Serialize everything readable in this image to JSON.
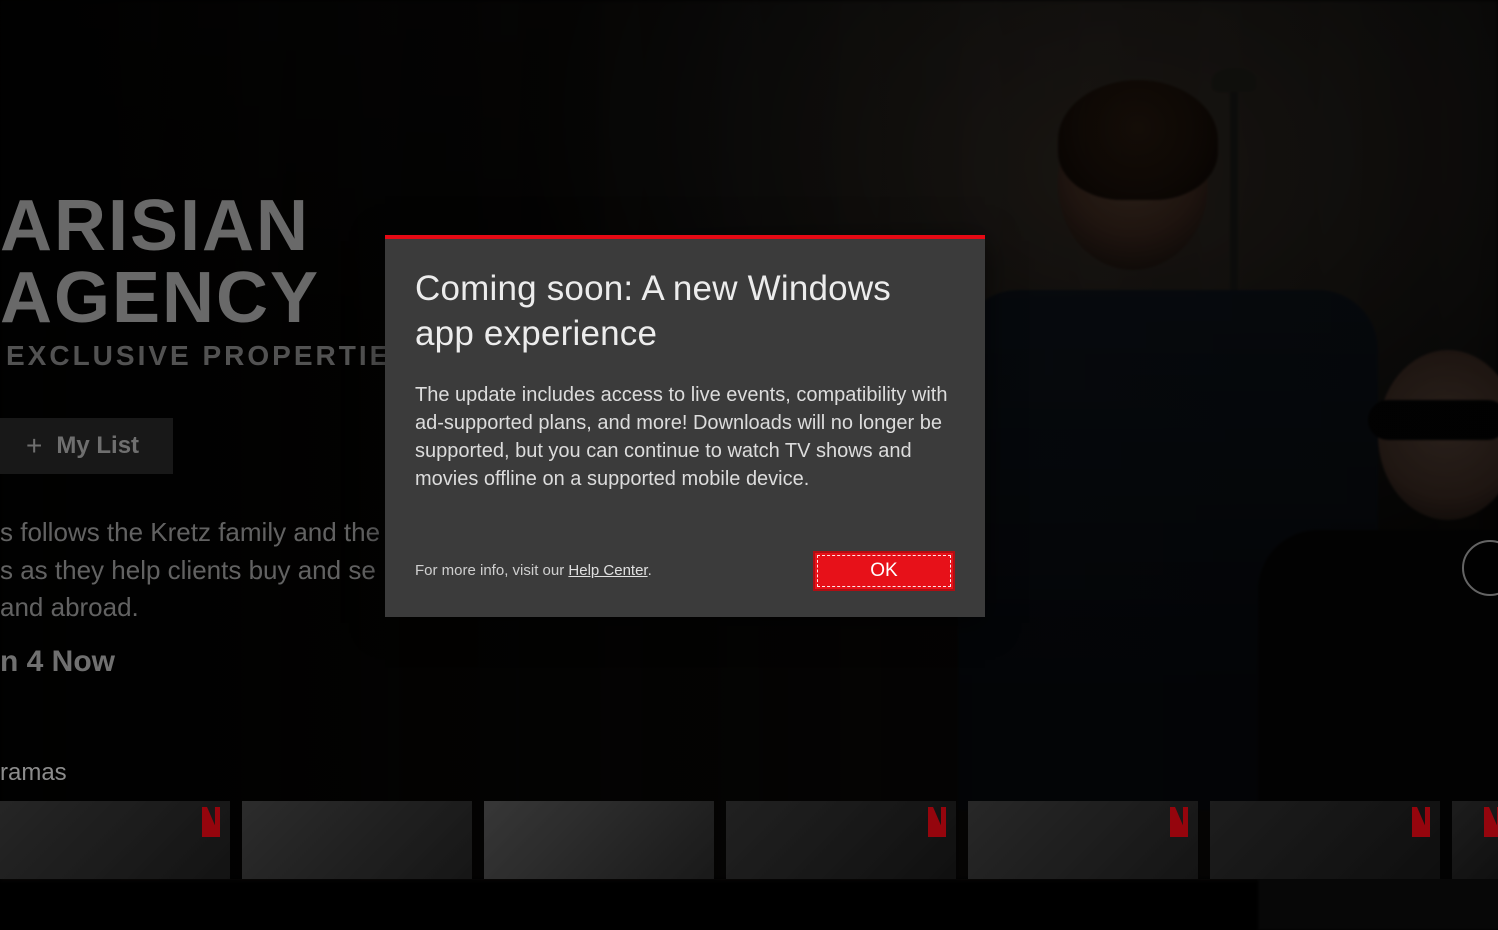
{
  "hero": {
    "title_line": "ARISIAN AGENCY",
    "title_sub": "EXCLUSIVE PROPERTIES",
    "mylist_label": "My List",
    "description": "s follows the Kretz family and the\ns as they help clients buy and se\n and abroad.",
    "cta": "n 4 Now"
  },
  "row": {
    "label": "ramas"
  },
  "dialog": {
    "title": "Coming soon: A new Windows app experience",
    "body": "The update includes access to live events, compatibility with ad-supported plans, and more! Downloads will no longer be supported, but you can continue to watch TV shows and movies offline on a supported mobile device.",
    "meta_prefix": "For more info, visit our ",
    "help_link_label": "Help Center",
    "meta_suffix": ".",
    "ok_label": "OK"
  }
}
